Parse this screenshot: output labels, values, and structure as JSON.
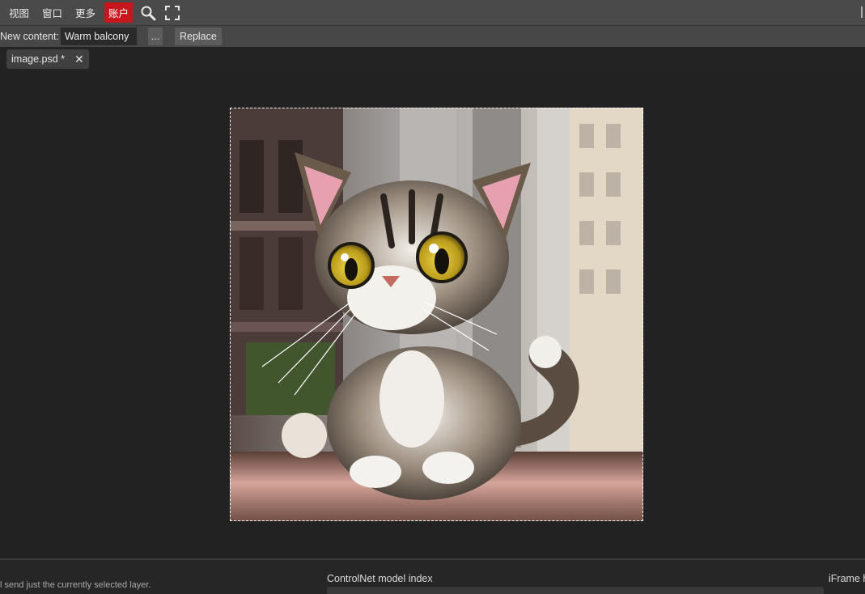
{
  "menubar": {
    "items": [
      "视图",
      "窗口",
      "更多"
    ],
    "account": "账户",
    "icons": [
      "search-icon",
      "fullscreen-icon"
    ]
  },
  "toolbar": {
    "new_content_label": "New content:",
    "new_content_value": "Warm balcony",
    "more_label": "...",
    "replace_label": "Replace"
  },
  "tabs": [
    {
      "label": "image.psd *",
      "modified": true
    }
  ],
  "bottom": {
    "hint": "l send just the currently selected layer.",
    "controlnet_label": "ControlNet model index",
    "iframe_label": "iFrame h"
  },
  "colors": {
    "menubar_bg": "#4a4a4a",
    "toolbar_bg": "#474747",
    "workspace_bg": "#222222",
    "account_accent": "#c8161d"
  }
}
